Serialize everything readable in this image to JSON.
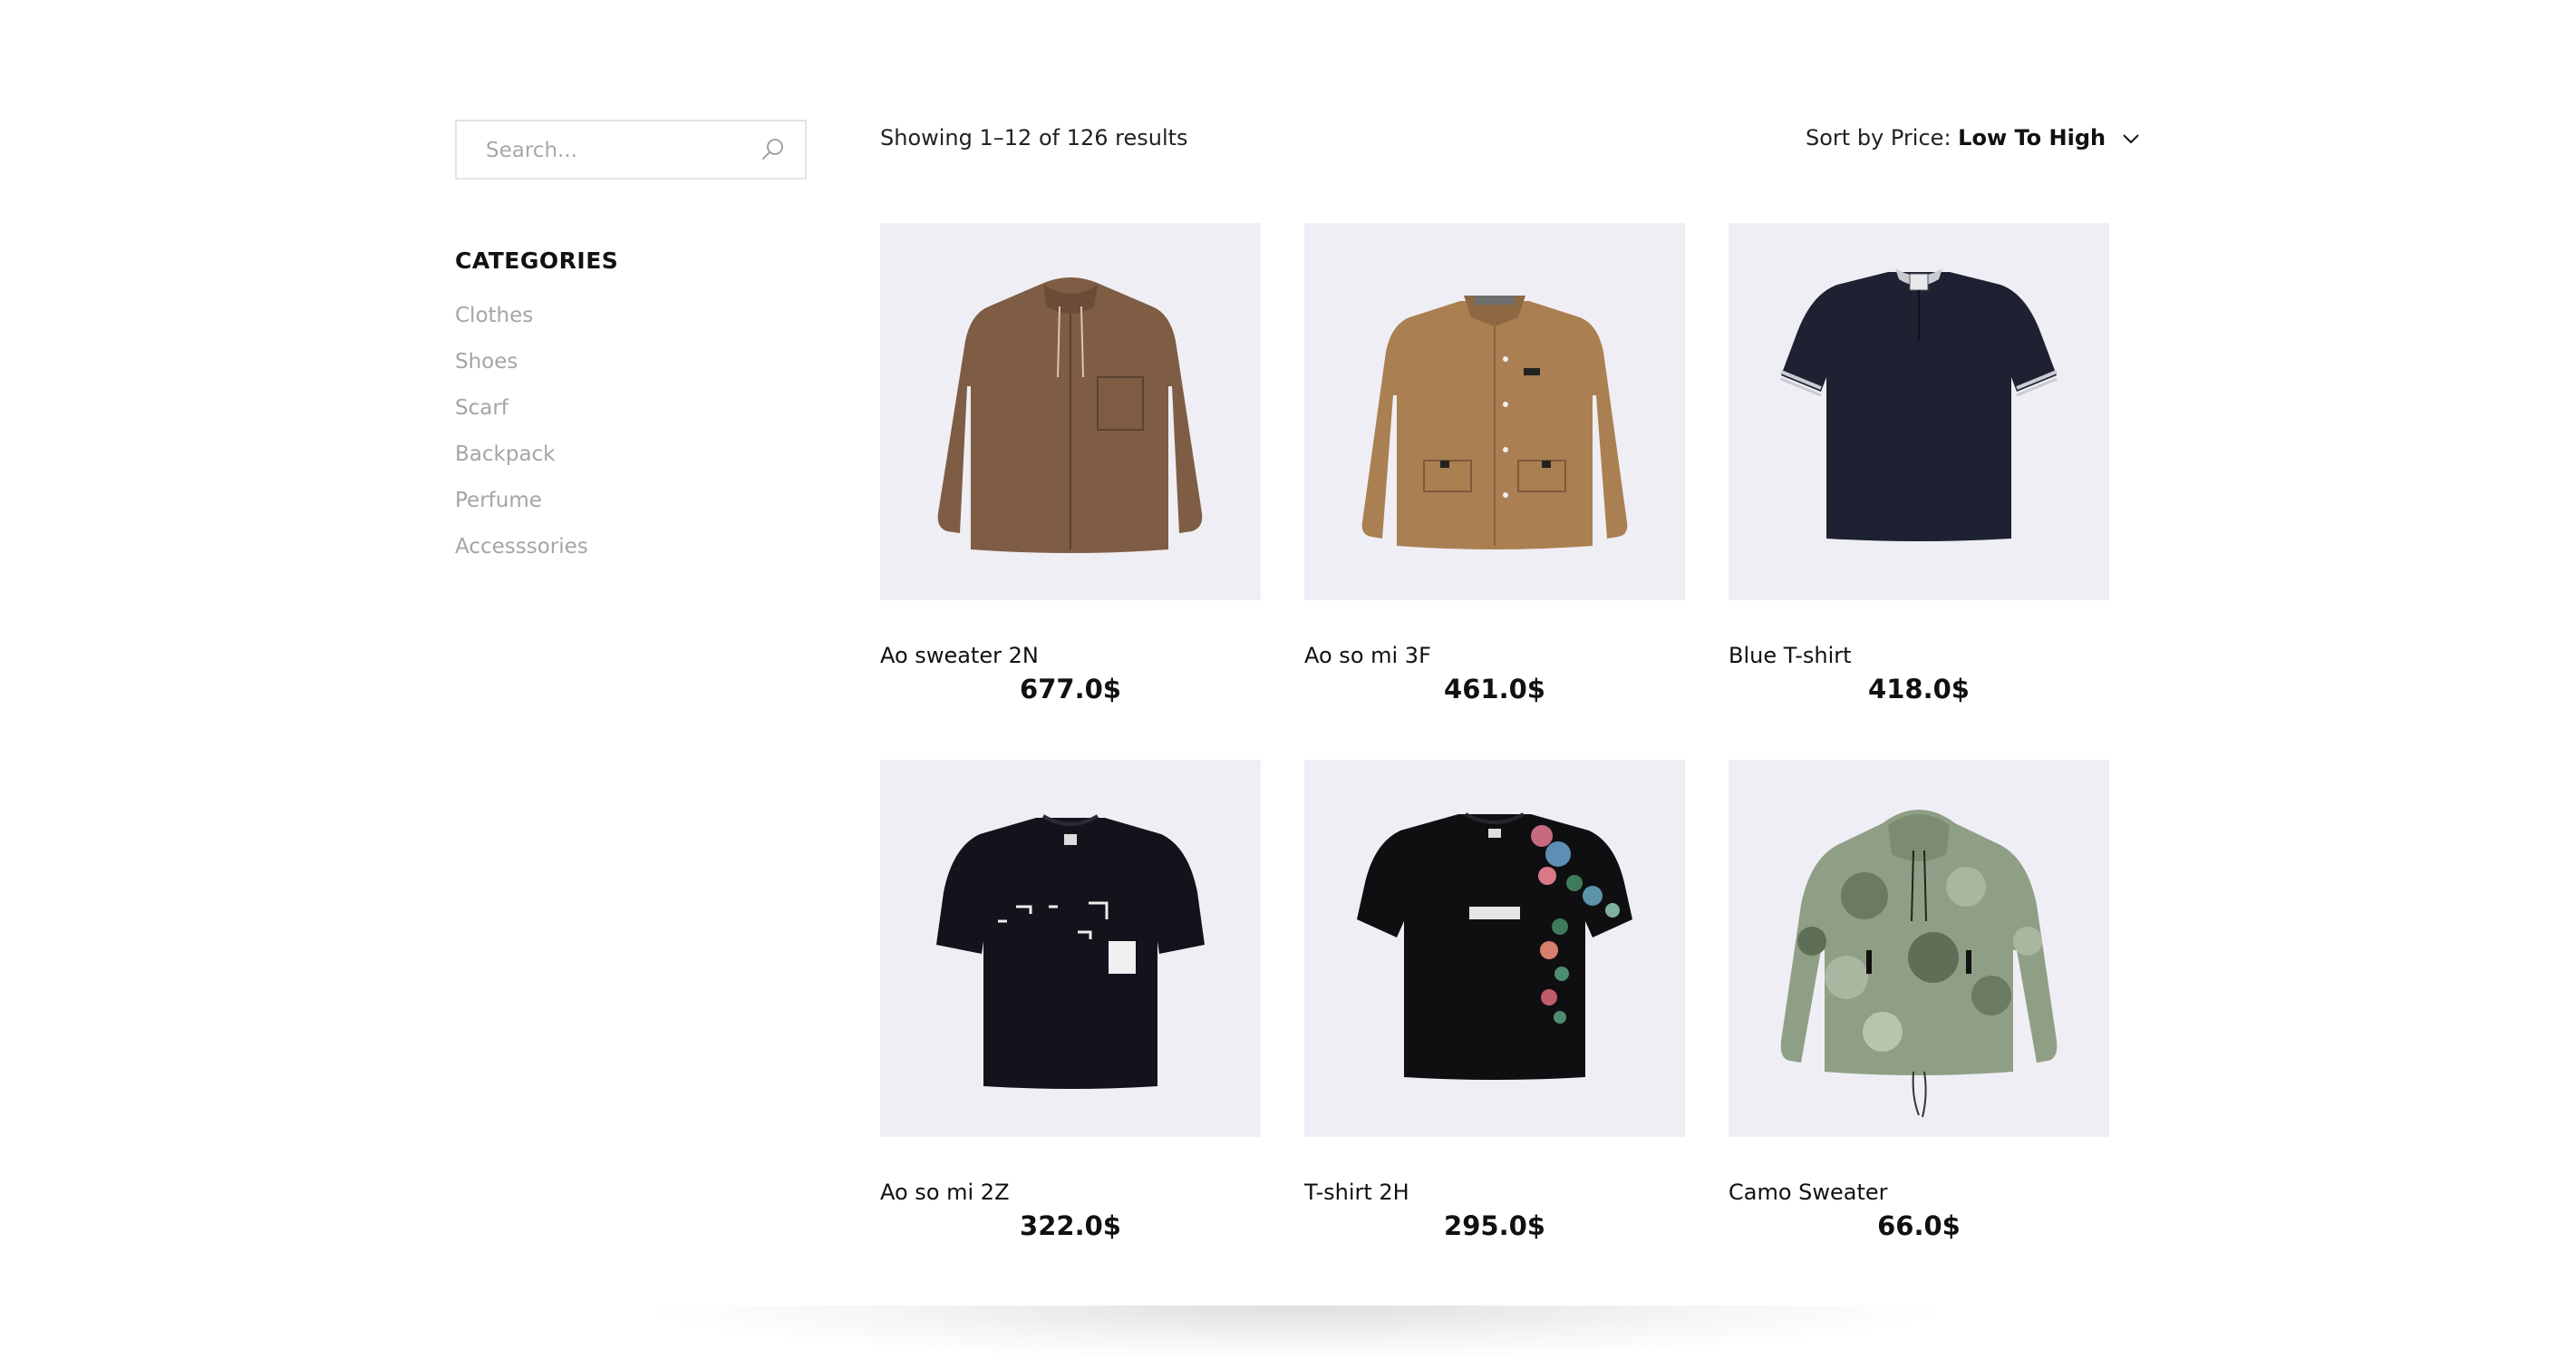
{
  "search": {
    "placeholder": "Search..."
  },
  "sidebar": {
    "title": "CATEGORIES",
    "categories": [
      "Clothes",
      "Shoes",
      "Scarf",
      "Backpack",
      "Perfume",
      "Accesssories"
    ]
  },
  "toolbar": {
    "result_count": "Showing 1–12 of 126 results",
    "sort_label": "Sort by Price:",
    "sort_value": "Low To High"
  },
  "products": [
    {
      "name": "Ao sweater 2N",
      "price": "677.0$",
      "image": "brown-hooded-jacket"
    },
    {
      "name": "Ao so mi 3F",
      "price": "461.0$",
      "image": "tan-shirt-jacket"
    },
    {
      "name": "Blue T-shirt",
      "price": "418.0$",
      "image": "navy-polo"
    },
    {
      "name": "Ao so mi 2Z",
      "price": "322.0$",
      "image": "black-graphic-tee"
    },
    {
      "name": "T-shirt 2H",
      "price": "295.0$",
      "image": "black-floral-tee"
    },
    {
      "name": "Camo Sweater",
      "price": "66.0$",
      "image": "camo-hoodie"
    }
  ],
  "colors": {
    "image_bg": "#efeef4",
    "muted_text": "#a5a5a5",
    "border": "#e4e4e4"
  }
}
